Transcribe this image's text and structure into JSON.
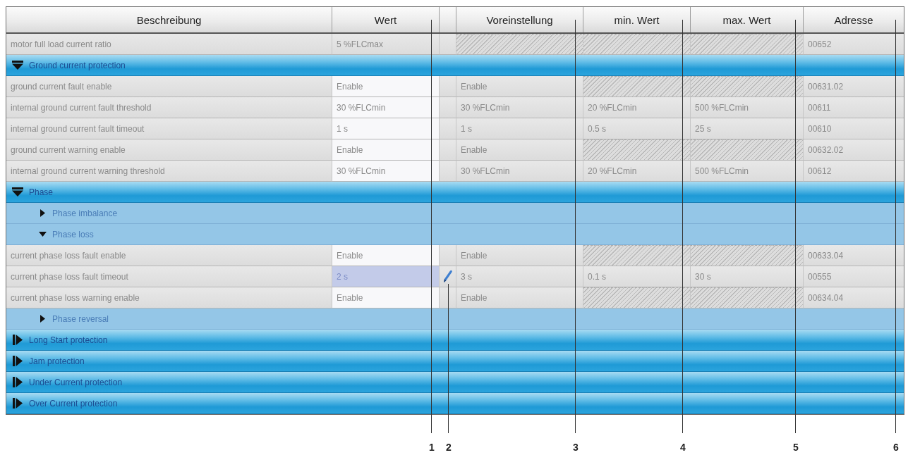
{
  "table": {
    "columns": [
      {
        "label": "Beschreibung"
      },
      {
        "label": "Wert"
      },
      {
        "label": "Voreinstellung"
      },
      {
        "label": "min. Wert"
      },
      {
        "label": "max. Wert"
      },
      {
        "label": "Adresse"
      }
    ],
    "rows": [
      {
        "kind": "parameter",
        "modified": false,
        "cells": [
          {
            "kind": "text",
            "text": "motor full load current ratio"
          },
          {
            "kind": "text",
            "text": "5 %FLCmax"
          },
          {
            "kind": "hatched"
          },
          {
            "kind": "hatched"
          },
          {
            "kind": "hatched"
          },
          {
            "kind": "text",
            "text": "00652"
          }
        ]
      },
      {
        "kind": "group",
        "label": "Ground current protection",
        "expanded": true,
        "children": [
          {
            "kind": "parameter",
            "modified": false,
            "cells": [
              {
                "kind": "text",
                "text": "ground current fault enable"
              },
              {
                "kind": "field",
                "text": "Enable",
                "selected": false
              },
              {
                "kind": "text",
                "text": "Enable"
              },
              {
                "kind": "hatched"
              },
              {
                "kind": "hatched"
              },
              {
                "kind": "text",
                "text": "00631.02"
              }
            ]
          },
          {
            "kind": "parameter",
            "modified": false,
            "cells": [
              {
                "kind": "text",
                "text": "internal ground current fault threshold"
              },
              {
                "kind": "field",
                "text": "30 %FLCmin",
                "selected": false
              },
              {
                "kind": "text",
                "text": "30 %FLCmin"
              },
              {
                "kind": "text",
                "text": "20 %FLCmin"
              },
              {
                "kind": "text",
                "text": "500 %FLCmin"
              },
              {
                "kind": "text",
                "text": "00611"
              }
            ]
          },
          {
            "kind": "parameter",
            "modified": false,
            "cells": [
              {
                "kind": "text",
                "text": "internal ground current fault timeout"
              },
              {
                "kind": "field",
                "text": "1 s",
                "selected": false
              },
              {
                "kind": "text",
                "text": "1 s"
              },
              {
                "kind": "text",
                "text": "0.5 s"
              },
              {
                "kind": "text",
                "text": "25 s"
              },
              {
                "kind": "text",
                "text": "00610"
              }
            ]
          },
          {
            "kind": "parameter",
            "modified": false,
            "cells": [
              {
                "kind": "text",
                "text": "ground current warning enable"
              },
              {
                "kind": "field",
                "text": "Enable",
                "selected": false
              },
              {
                "kind": "text",
                "text": "Enable"
              },
              {
                "kind": "hatched"
              },
              {
                "kind": "hatched"
              },
              {
                "kind": "text",
                "text": "00632.02"
              }
            ]
          },
          {
            "kind": "parameter",
            "modified": false,
            "cells": [
              {
                "kind": "text",
                "text": "internal ground current warning threshold"
              },
              {
                "kind": "field",
                "text": "30 %FLCmin",
                "selected": false
              },
              {
                "kind": "text",
                "text": "30 %FLCmin"
              },
              {
                "kind": "text",
                "text": "20 %FLCmin"
              },
              {
                "kind": "text",
                "text": "500 %FLCmin"
              },
              {
                "kind": "text",
                "text": "00612"
              }
            ]
          }
        ]
      },
      {
        "kind": "group",
        "label": "Phase",
        "expanded": true,
        "children": [
          {
            "kind": "group",
            "label": "Phase imbalance",
            "expanded": false
          },
          {
            "kind": "group",
            "label": "Phase loss",
            "expanded": true,
            "children": [
              {
                "kind": "parameter",
                "modified": false,
                "cells": [
                  {
                    "kind": "text",
                    "text": "current phase loss fault enable"
                  },
                  {
                    "kind": "field",
                    "text": "Enable",
                    "selected": false
                  },
                  {
                    "kind": "text",
                    "text": "Enable"
                  },
                  {
                    "kind": "hatched"
                  },
                  {
                    "kind": "hatched"
                  },
                  {
                    "kind": "text",
                    "text": "00633.04"
                  }
                ]
              },
              {
                "kind": "parameter",
                "modified": true,
                "cells": [
                  {
                    "kind": "text",
                    "text": "current phase loss fault timeout"
                  },
                  {
                    "kind": "field",
                    "text": "2 s",
                    "selected": true
                  },
                  {
                    "kind": "text",
                    "text": "3 s"
                  },
                  {
                    "kind": "text",
                    "text": "0.1 s"
                  },
                  {
                    "kind": "text",
                    "text": "30 s"
                  },
                  {
                    "kind": "text",
                    "text": "00555"
                  }
                ]
              },
              {
                "kind": "parameter",
                "modified": false,
                "cells": [
                  {
                    "kind": "text",
                    "text": "current phase loss warning enable"
                  },
                  {
                    "kind": "field",
                    "text": "Enable",
                    "selected": false
                  },
                  {
                    "kind": "text",
                    "text": "Enable"
                  },
                  {
                    "kind": "hatched"
                  },
                  {
                    "kind": "hatched"
                  },
                  {
                    "kind": "text",
                    "text": "00634.04"
                  }
                ]
              }
            ]
          },
          {
            "kind": "group",
            "label": "Phase reversal",
            "expanded": false
          }
        ]
      },
      {
        "kind": "group",
        "label": "Long Start protection",
        "expanded": false
      },
      {
        "kind": "group",
        "label": "Jam protection",
        "expanded": false
      },
      {
        "kind": "group",
        "label": "Under Current protection",
        "expanded": false
      },
      {
        "kind": "group",
        "label": "Over Current protection",
        "expanded": false
      }
    ]
  },
  "callouts": [
    {
      "label": "1"
    },
    {
      "label": "2"
    },
    {
      "label": "3"
    },
    {
      "label": "4"
    },
    {
      "label": "5"
    },
    {
      "label": "6"
    }
  ]
}
